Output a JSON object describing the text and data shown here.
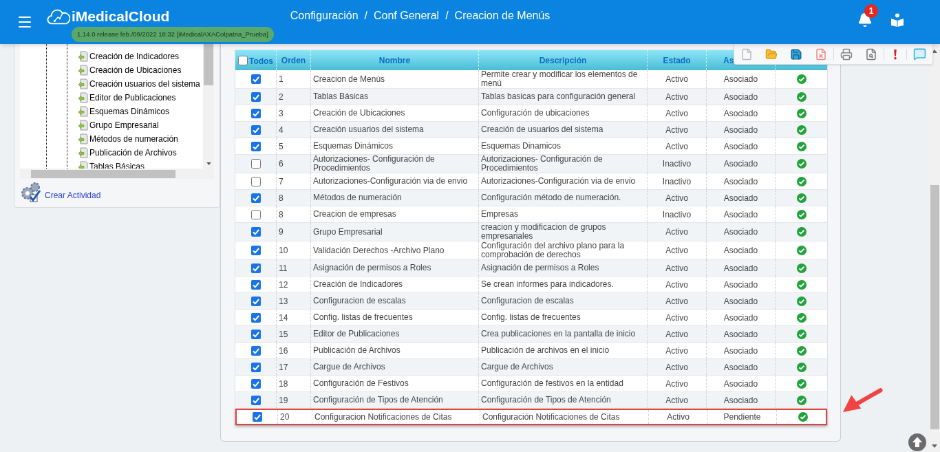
{
  "header": {
    "app_name": "iMedicalCloud",
    "version": "1.14.0 release feb./09/2022 18:32 [iMedicalAXAColpatria_Prueba]",
    "breadcrumb": [
      "Configuración",
      "Conf General",
      "Creacion de Menús"
    ],
    "separator": "/",
    "notification_count": "1"
  },
  "tree": {
    "items": [
      {
        "label": "Creación de Indicadores"
      },
      {
        "label": "Creación de Ubicaciones"
      },
      {
        "label": "Creación usuarios del sistema"
      },
      {
        "label": "Editor de Publicaciones"
      },
      {
        "label": "Esquemas Dinámicos"
      },
      {
        "label": "Grupo Empresarial"
      },
      {
        "label": "Métodos de numeración"
      },
      {
        "label": "Publicación de Archivos"
      },
      {
        "label": "Tablas Básicas"
      }
    ]
  },
  "create_activity_link": "Crear Actividad",
  "table": {
    "select_all": {
      "label": "Todos",
      "checked": false
    },
    "columns": [
      "Orden",
      "Nombre",
      "Descripción",
      "Estado",
      "As"
    ],
    "rows": [
      {
        "checked": true,
        "orden": "1",
        "nombre": "Creacion de Menús",
        "descripcion": "Permite crear y modificar los elementos de menú",
        "estado": "Activo",
        "asociado": "Asociado",
        "highlighted": false
      },
      {
        "checked": true,
        "orden": "2",
        "nombre": "Tablas Básicas",
        "descripcion": "Tablas basicas para configuración general",
        "estado": "Activo",
        "asociado": "Asociado",
        "highlighted": false
      },
      {
        "checked": true,
        "orden": "3",
        "nombre": "Creación de Ubicaciones",
        "descripcion": "Configuración de ubicaciones",
        "estado": "Activo",
        "asociado": "Asociado",
        "highlighted": false
      },
      {
        "checked": true,
        "orden": "4",
        "nombre": "Creación usuarios del sistema",
        "descripcion": "Creación de usuarios del sistema",
        "estado": "Activo",
        "asociado": "Asociado",
        "highlighted": false
      },
      {
        "checked": true,
        "orden": "5",
        "nombre": "Esquemas Dinámicos",
        "descripcion": "Esquemas Dinamicos",
        "estado": "Activo",
        "asociado": "Asociado",
        "highlighted": false
      },
      {
        "checked": false,
        "orden": "6",
        "nombre": "Autorizaciones- Configuración de Procedimientos",
        "descripcion": "Autorizaciones- Configuración de Procedimientos",
        "estado": "Inactivo",
        "asociado": "Asociado",
        "highlighted": false
      },
      {
        "checked": false,
        "orden": "7",
        "nombre": "Autorizaciones-Configuración via de envio",
        "descripcion": "Autorizaciones-Configuración via de envio",
        "estado": "Inactivo",
        "asociado": "Asociado",
        "highlighted": false
      },
      {
        "checked": true,
        "orden": "8",
        "nombre": "Métodos de numeración",
        "descripcion": "Configuración método de numeración.",
        "estado": "Activo",
        "asociado": "Asociado",
        "highlighted": false
      },
      {
        "checked": false,
        "orden": "8",
        "nombre": "Creacion de empresas",
        "descripcion": "Empresas",
        "estado": "Inactivo",
        "asociado": "Asociado",
        "highlighted": false
      },
      {
        "checked": true,
        "orden": "9",
        "nombre": "Grupo Empresarial",
        "descripcion": "creacion y modificacion de grupos empresariales",
        "estado": "Activo",
        "asociado": "Asociado",
        "highlighted": false
      },
      {
        "checked": true,
        "orden": "10",
        "nombre": "Validación Derechos -Archivo Plano",
        "descripcion": "Configuración del archivo plano para la comprobación de derechos",
        "estado": "Activo",
        "asociado": "Asociado",
        "highlighted": false
      },
      {
        "checked": true,
        "orden": "11",
        "nombre": "Asignación de permisos a Roles",
        "descripcion": "Asignación de permisos a Roles",
        "estado": "Activo",
        "asociado": "Asociado",
        "highlighted": false
      },
      {
        "checked": true,
        "orden": "12",
        "nombre": "Creación de Indicadores",
        "descripcion": "Se crean informes para indicadores.",
        "estado": "Activo",
        "asociado": "Asociado",
        "highlighted": false
      },
      {
        "checked": true,
        "orden": "13",
        "nombre": "Configuracion de escalas",
        "descripcion": "Configuracion de escalas",
        "estado": "Activo",
        "asociado": "Asociado",
        "highlighted": false
      },
      {
        "checked": true,
        "orden": "14",
        "nombre": "Config. listas de frecuentes",
        "descripcion": "Config. listas de frecuentes",
        "estado": "Activo",
        "asociado": "Asociado",
        "highlighted": false
      },
      {
        "checked": true,
        "orden": "15",
        "nombre": "Editor de Publicaciones",
        "descripcion": "Crea publicaciones en la pantalla de inicio",
        "estado": "Activo",
        "asociado": "Asociado",
        "highlighted": false
      },
      {
        "checked": true,
        "orden": "16",
        "nombre": "Publicación de Archivos",
        "descripcion": "Publicación de archivos en el inicio",
        "estado": "Activo",
        "asociado": "Asociado",
        "highlighted": false
      },
      {
        "checked": true,
        "orden": "17",
        "nombre": "Cargue de Archivos",
        "descripcion": "Cargue de Archivos",
        "estado": "Activo",
        "asociado": "Asociado",
        "highlighted": false
      },
      {
        "checked": true,
        "orden": "18",
        "nombre": "Configuración de Festivos",
        "descripcion": "Configuración de festivos en la entidad",
        "estado": "Activo",
        "asociado": "Asociado",
        "highlighted": false
      },
      {
        "checked": true,
        "orden": "19",
        "nombre": "Configuración de Tipos de Atención",
        "descripcion": "Configuración de Tipos de Atención",
        "estado": "Activo",
        "asociado": "Asociado",
        "highlighted": false
      },
      {
        "checked": true,
        "orden": "20",
        "nombre": "Configuracion Notificaciones de Citas",
        "descripcion": "Configuración Notificaciones de Citas",
        "estado": "Activo",
        "asociado": "Pendiente",
        "highlighted": true
      }
    ]
  }
}
